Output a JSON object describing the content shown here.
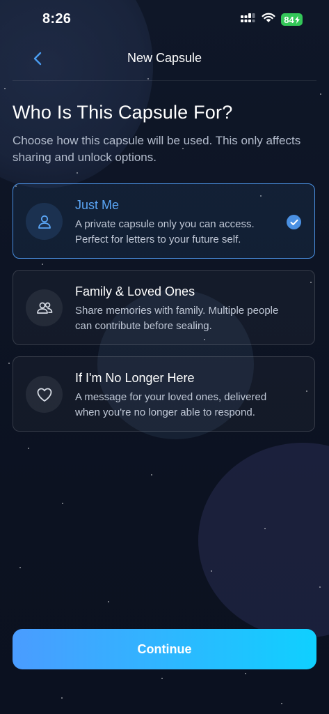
{
  "status_bar": {
    "time": "8:26",
    "battery": "84",
    "icons": [
      "signal-icon",
      "wifi-icon",
      "battery-charging-icon"
    ]
  },
  "nav": {
    "title": "New Capsule",
    "back_icon": "chevron-left-icon"
  },
  "header": {
    "title": "Who Is This Capsule For?",
    "subtitle": "Choose how this capsule will be used. This only affects sharing and unlock options."
  },
  "options": [
    {
      "title": "Just Me",
      "description": "A private capsule only you can access. Perfect for letters to your future self.",
      "icon": "person-icon",
      "selected": true
    },
    {
      "title": "Family & Loved Ones",
      "description": "Share memories with family. Multiple people can contribute before sealing.",
      "icon": "people-icon",
      "selected": false
    },
    {
      "title": "If I'm No Longer Here",
      "description": "A message for your loved ones, delivered when you're no longer able to respond.",
      "icon": "heart-icon",
      "selected": false
    }
  ],
  "footer": {
    "continue_label": "Continue"
  },
  "colors": {
    "accent": "#4a90e2",
    "background": "#0e1526",
    "button_gradient_start": "#4a9cff",
    "button_gradient_end": "#0fd0ff"
  }
}
